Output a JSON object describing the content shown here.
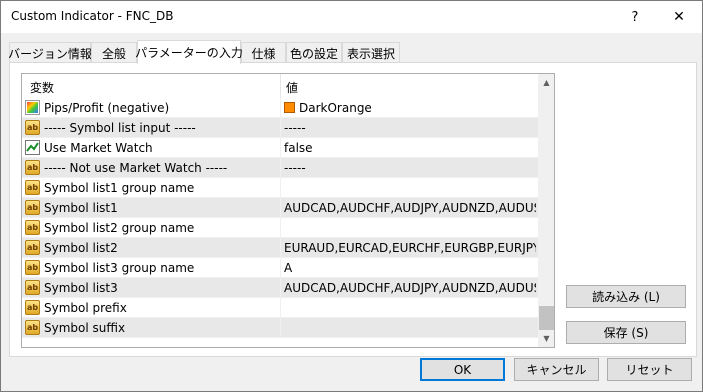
{
  "window": {
    "title": "Custom Indicator - FNC_DB",
    "help_label": "?",
    "close_label": "✕"
  },
  "tabs": [
    {
      "label": "バージョン情報"
    },
    {
      "label": "全般"
    },
    {
      "label": "パラメーターの入力",
      "active": true
    },
    {
      "label": "仕様"
    },
    {
      "label": "色の設定"
    },
    {
      "label": "表示選択"
    }
  ],
  "list": {
    "header_variable": "変数",
    "header_value": "値",
    "rows": [
      {
        "name": "Pips/Profit (negative)",
        "value": "DarkOrange",
        "icon": "color-icon",
        "swatch": "#ff8c00"
      },
      {
        "name": "----- Symbol list input -----",
        "value": "-----",
        "icon": "ab-icon"
      },
      {
        "name": "Use Market Watch",
        "value": "false",
        "icon": "bool-icon"
      },
      {
        "name": "----- Not use Market Watch -----",
        "value": "-----",
        "icon": "ab-icon"
      },
      {
        "name": "Symbol list1 group name",
        "value": "",
        "icon": "ab-icon"
      },
      {
        "name": "Symbol list1",
        "value": "AUDCAD,AUDCHF,AUDJPY,AUDNZD,AUDUSD...",
        "icon": "ab-icon"
      },
      {
        "name": "Symbol list2 group name",
        "value": "",
        "icon": "ab-icon"
      },
      {
        "name": "Symbol list2",
        "value": "EURAUD,EURCAD,EURCHF,EURGBP,EURJPY,E...",
        "icon": "ab-icon"
      },
      {
        "name": "Symbol list3 group name",
        "value": "A",
        "icon": "ab-icon"
      },
      {
        "name": "Symbol list3",
        "value": "AUDCAD,AUDCHF,AUDJPY,AUDNZD,AUDUSD...",
        "icon": "ab-icon"
      },
      {
        "name": "Symbol prefix",
        "value": "",
        "icon": "ab-icon"
      },
      {
        "name": "Symbol suffix",
        "value": "",
        "icon": "ab-icon"
      }
    ]
  },
  "side_buttons": {
    "load_label": "読み込み (L)",
    "save_label": "保存 (S)"
  },
  "footer": {
    "ok_label": "OK",
    "cancel_label": "キャンセル",
    "reset_label": "リセット"
  }
}
